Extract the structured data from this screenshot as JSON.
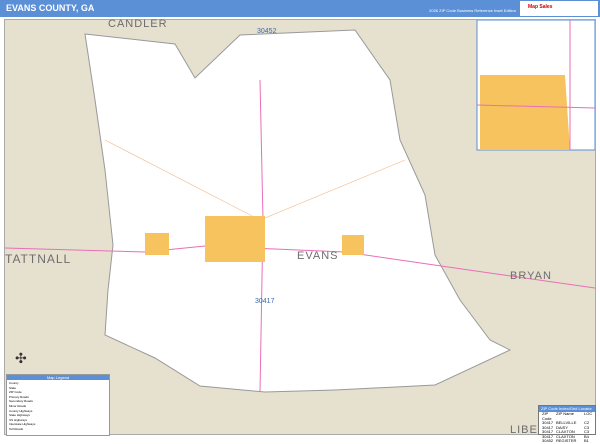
{
  "header": {
    "title": "EVANS COUNTY, GA",
    "subtitle": "2026 ZIP Code Business Reference Inset Edition",
    "logo_text": "Map Sales"
  },
  "map": {
    "counties": [
      "CANDLER",
      "TATTNALL",
      "EVANS",
      "BRYAN",
      "LIBERTY"
    ],
    "zip_labels": [
      "30452",
      "30417"
    ],
    "colors": {
      "county_fill": "#ffffff",
      "surrounding": "#e6e0cf",
      "city": "#f7c35f",
      "water": "#7ab0e0",
      "highway": "#e86fb8"
    }
  },
  "legend": {
    "title": "Map Legend",
    "items": [
      "County",
      "State",
      "ZIP Code",
      "Primary Roads",
      "Secondary Roads",
      "Minor Roads",
      "County Highways",
      "State Highways",
      "US Highways",
      "Interstate Highways",
      "Toll Roads"
    ]
  },
  "zip_table": {
    "title": "ZIP Code Index/Grid Locator",
    "columns": [
      "ZIP Code",
      "ZIP Name",
      "LOC"
    ],
    "rows": [
      [
        "30417",
        "BELLVILLE",
        "C2"
      ],
      [
        "30417",
        "DAISY",
        "C3"
      ],
      [
        "30417",
        "CLAXTON",
        "C3"
      ],
      [
        "30417",
        "CLAXTON",
        "B4"
      ],
      [
        "30452",
        "REGISTER",
        "B1"
      ]
    ]
  }
}
